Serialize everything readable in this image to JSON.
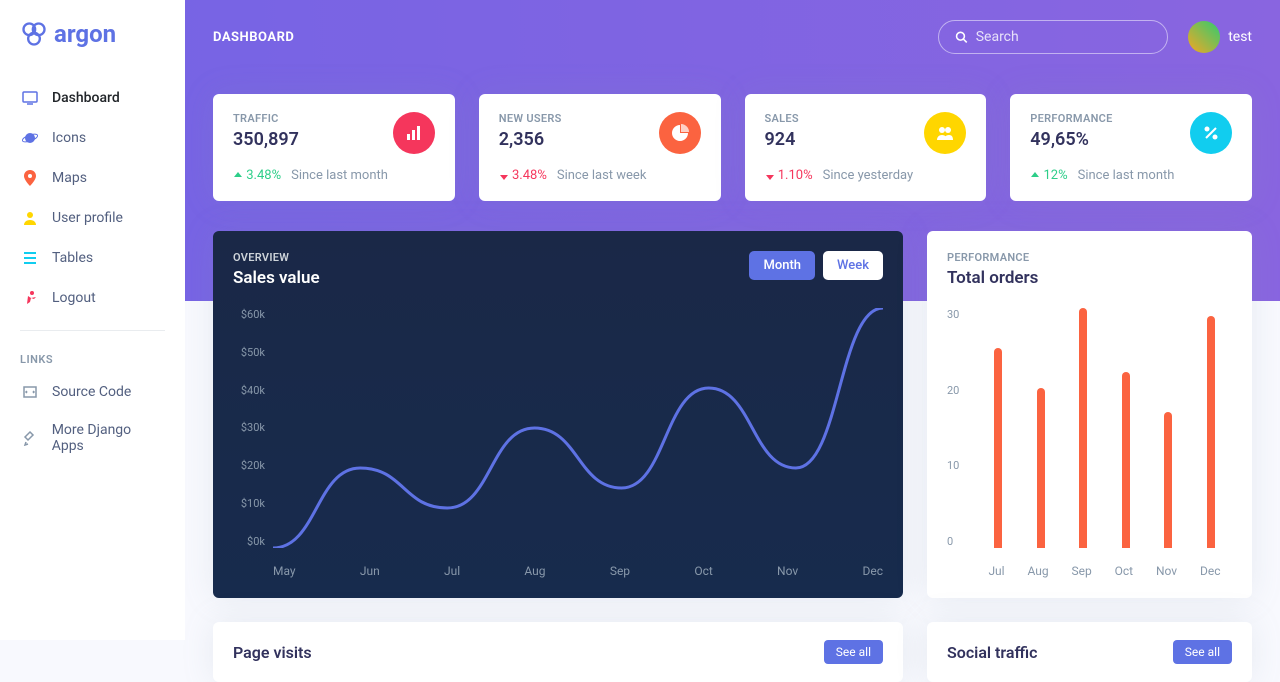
{
  "brand": "argon",
  "nav": {
    "dashboard": "Dashboard",
    "icons": "Icons",
    "maps": "Maps",
    "profile": "User profile",
    "tables": "Tables",
    "logout": "Logout"
  },
  "links": {
    "header": "LINKS",
    "source": "Source Code",
    "more": "More Django Apps"
  },
  "header": {
    "title": "DASHBOARD",
    "search_placeholder": "Search",
    "user": "test"
  },
  "stats": [
    {
      "label": "TRAFFIC",
      "value": "350,897",
      "change": "3.48%",
      "dir": "up",
      "since": "Since last month"
    },
    {
      "label": "NEW USERS",
      "value": "2,356",
      "change": "3.48%",
      "dir": "down",
      "since": "Since last week"
    },
    {
      "label": "SALES",
      "value": "924",
      "change": "1.10%",
      "dir": "down",
      "since": "Since yesterday"
    },
    {
      "label": "PERFORMANCE",
      "value": "49,65%",
      "change": "12%",
      "dir": "up",
      "since": "Since last month"
    }
  ],
  "sales_chart": {
    "overline": "OVERVIEW",
    "title": "Sales value",
    "tabs": {
      "month": "Month",
      "week": "Week"
    }
  },
  "orders_chart": {
    "overline": "PERFORMANCE",
    "title": "Total orders"
  },
  "page_visits": {
    "title": "Page visits",
    "see_all": "See all"
  },
  "social": {
    "title": "Social traffic",
    "see_all": "See all"
  },
  "chart_data": [
    {
      "type": "line",
      "title": "Sales value",
      "categories": [
        "May",
        "Jun",
        "Jul",
        "Aug",
        "Sep",
        "Oct",
        "Nov",
        "Dec"
      ],
      "values": [
        0,
        20,
        10,
        30,
        15,
        40,
        20,
        60
      ],
      "ylabel": "$k",
      "ylim": [
        0,
        60
      ],
      "yticks": [
        "$0k",
        "$10k",
        "$20k",
        "$30k",
        "$40k",
        "$50k",
        "$60k"
      ]
    },
    {
      "type": "bar",
      "title": "Total orders",
      "categories": [
        "Jul",
        "Aug",
        "Sep",
        "Oct",
        "Nov",
        "Dec"
      ],
      "values": [
        25,
        20,
        30,
        22,
        17,
        29
      ],
      "ylim": [
        0,
        30
      ],
      "yticks": [
        "0",
        "10",
        "20",
        "30"
      ]
    }
  ]
}
